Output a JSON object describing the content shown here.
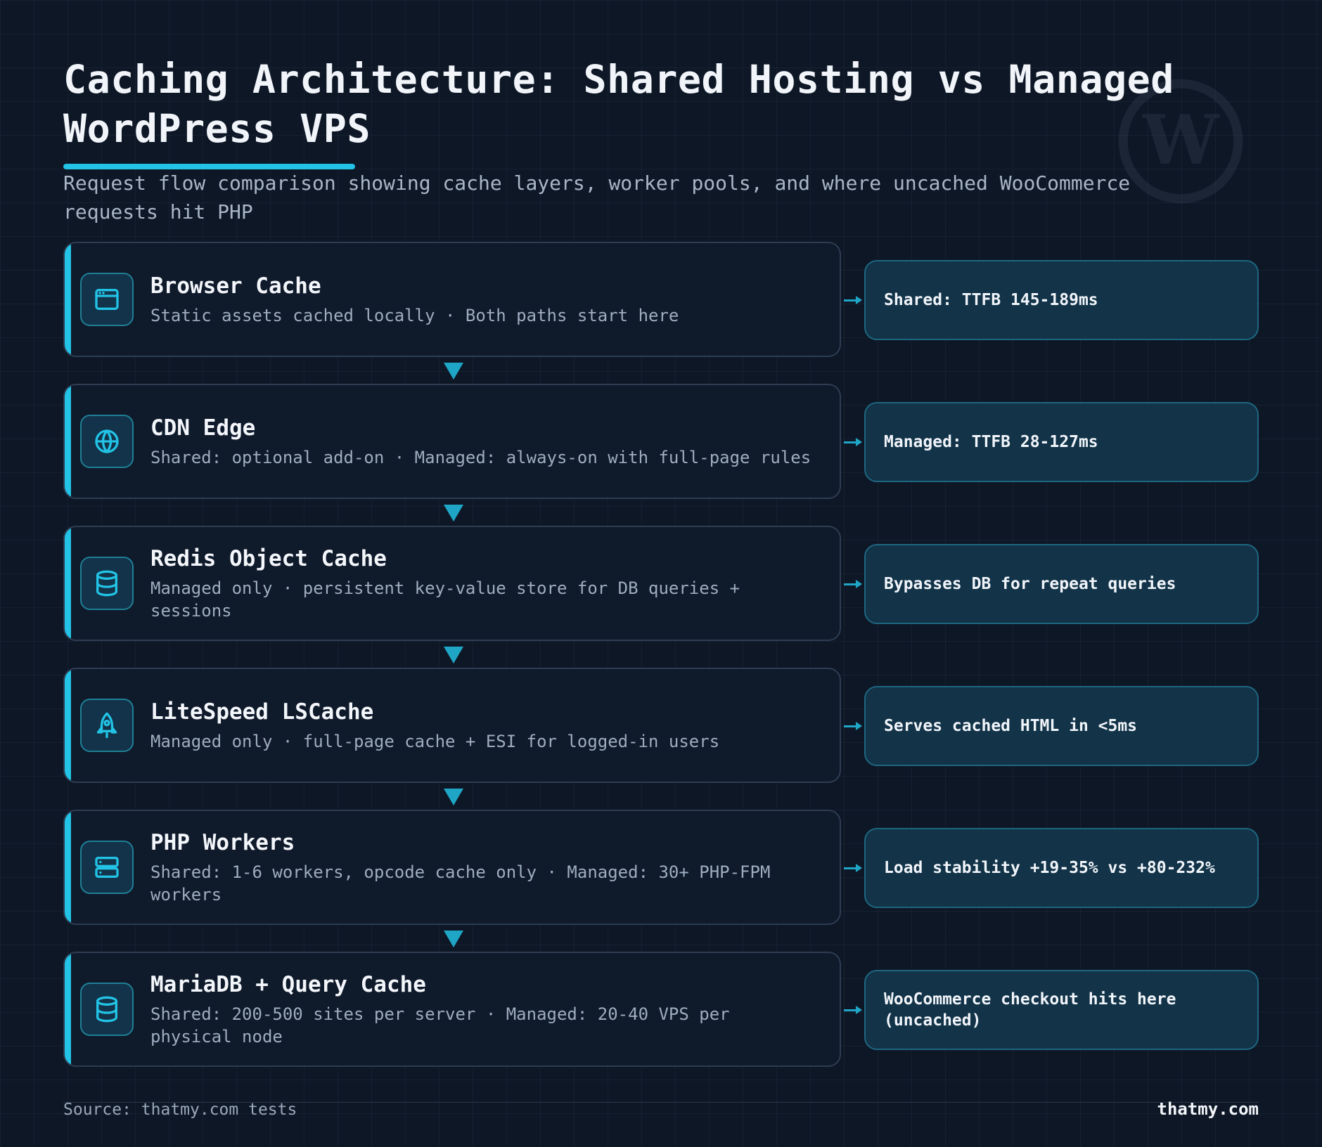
{
  "header": {
    "title": "Caching Architecture: Shared Hosting vs Managed WordPress VPS",
    "subtitle": "Request flow comparison showing cache layers, worker pools, and where uncached WooCommerce requests hit PHP"
  },
  "stages": [
    {
      "name": "Browser Cache",
      "desc": "Static assets cached locally · Both paths start here",
      "icon": "browser-window-icon",
      "metric": "Shared: TTFB 145-189ms"
    },
    {
      "name": "CDN Edge",
      "desc": "Shared: optional add-on · Managed: always-on with full-page rules",
      "icon": "globe-icon",
      "metric": "Managed: TTFB 28-127ms"
    },
    {
      "name": "Redis Object Cache",
      "desc": "Managed only · persistent key-value store for DB queries + sessions",
      "icon": "database-icon",
      "metric": "Bypasses DB for repeat queries"
    },
    {
      "name": "LiteSpeed LSCache",
      "desc": "Managed only · full-page cache + ESI for logged-in users",
      "icon": "rocket-icon",
      "metric": "Serves cached HTML in <5ms"
    },
    {
      "name": "PHP Workers",
      "desc": "Shared: 1-6 workers, opcode cache only · Managed: 30+ PHP-FPM workers",
      "icon": "server-icon",
      "metric": "Load stability +19-35% vs +80-232%"
    },
    {
      "name": "MariaDB + Query Cache",
      "desc": "Shared: 200-500 sites per server · Managed: 20-40 VPS per physical node",
      "icon": "database-icon",
      "metric": "WooCommerce checkout hits here (uncached)"
    }
  ],
  "footer": {
    "source": "Source: thatmy.com tests",
    "brand": "thatmy.com"
  },
  "colors": {
    "accent": "#22c3e6",
    "background": "#0e1726",
    "card": "#0f1a2b",
    "metric_card": "#123348"
  }
}
